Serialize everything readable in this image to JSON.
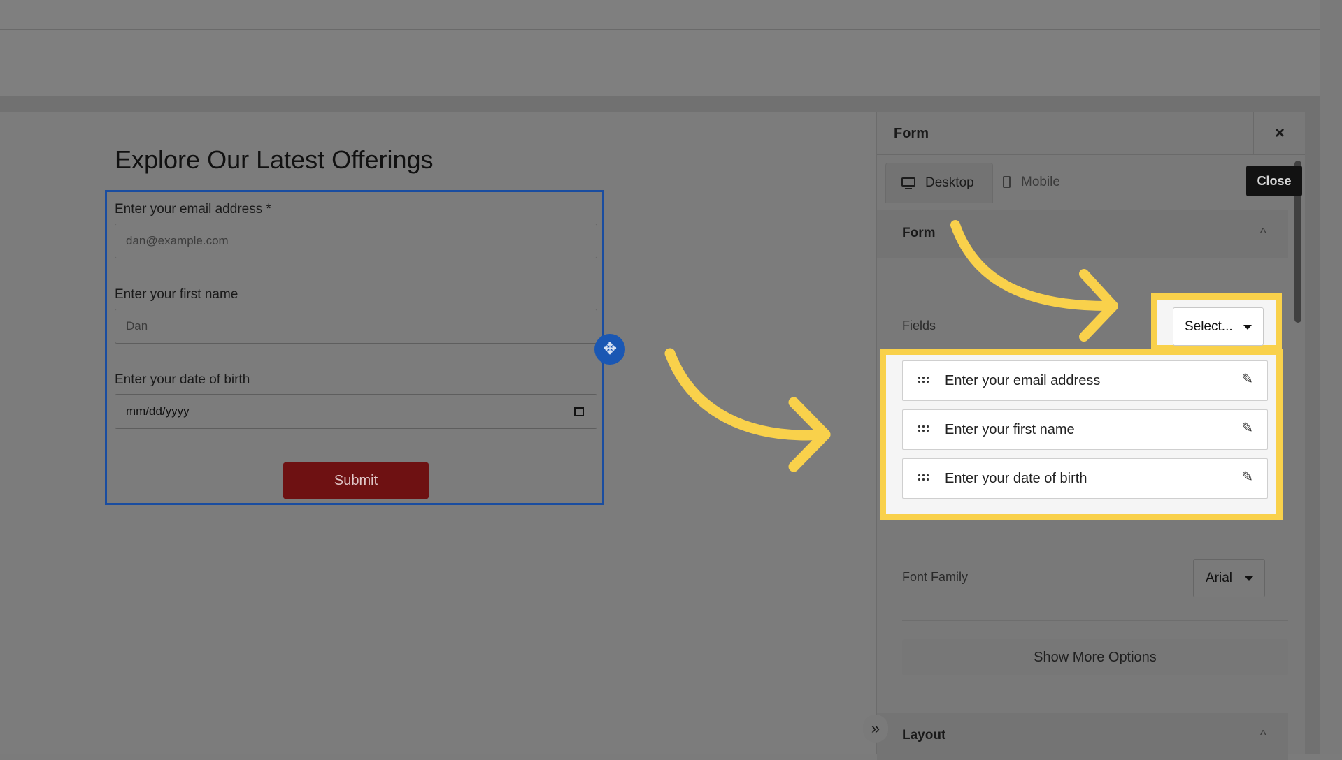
{
  "canvas": {
    "title": "Explore Our Latest Offerings",
    "fields": [
      {
        "label": "Enter your email address *",
        "placeholder": "dan@example.com"
      },
      {
        "label": "Enter your first name",
        "placeholder": "Dan"
      },
      {
        "label": "Enter your date of birth",
        "placeholder": "mm/dd/yyyy"
      }
    ],
    "submit_label": "Submit",
    "move_icon": "✥"
  },
  "panel": {
    "title": "Form",
    "close_symbol": "×",
    "tooltip": "Close",
    "tabs": [
      {
        "label": "Desktop"
      },
      {
        "label": "Mobile"
      }
    ],
    "section_form": "Form",
    "fields_label": "Fields",
    "select_label": "Select...",
    "field_items": [
      {
        "name": "Enter your email address"
      },
      {
        "name": "Enter your first name"
      },
      {
        "name": "Enter your date of birth"
      }
    ],
    "font_family_label": "Font Family",
    "font_family_value": "Arial",
    "show_more": "Show More Options",
    "section_layout": "Layout",
    "chevron": "^",
    "collapse_symbol": "»",
    "edit_icon": "✎"
  },
  "colors": {
    "highlight": "#f9d14b",
    "selection_border": "#1a4da0",
    "submit_bg": "#6e1112"
  }
}
